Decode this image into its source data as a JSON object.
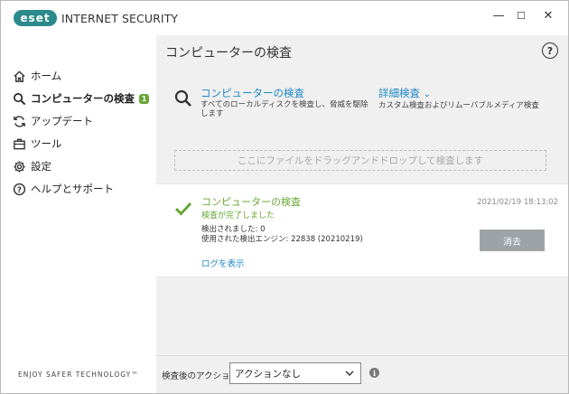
{
  "app": {
    "logo_badge": "eset",
    "product_name": "INTERNET SECURITY",
    "tagline": "ENJOY SAFER TECHNOLOGY™"
  },
  "window_controls": {
    "minimize": "—",
    "maximize": "☐",
    "close": "✕"
  },
  "sidebar": {
    "items": [
      {
        "label": "ホーム",
        "icon": "home-icon"
      },
      {
        "label": "コンピューターの検査",
        "icon": "search-icon",
        "badge": "1",
        "active": true
      },
      {
        "label": "アップデート",
        "icon": "update-icon"
      },
      {
        "label": "ツール",
        "icon": "toolbox-icon"
      },
      {
        "label": "設定",
        "icon": "gear-icon"
      },
      {
        "label": "ヘルプとサポート",
        "icon": "help-circle-icon"
      }
    ]
  },
  "main": {
    "title": "コンピューターの検査",
    "help": "?",
    "options": [
      {
        "title": "コンピューターの検査",
        "desc_line1": "すべてのローカルディスクを検査し、脅威を駆除",
        "desc_line2": "します"
      },
      {
        "title": "詳細検査",
        "chevron": "⌄",
        "desc_line1": "カスタム検査およびリムーバブルメディア検査"
      }
    ],
    "dropzone": "ここにファイルをドラッグアンドドロップして検査します",
    "result": {
      "title": "コンピューターの検査",
      "status": "検査が完了しました",
      "timestamp": "2021/02/19 18:13:02",
      "detected": "検出されました: 0",
      "engine": "使用された検出エンジン: 22838 (20210219)",
      "clear_button": "消去",
      "log_link": "ログを表示"
    },
    "after_scan": {
      "label": "検査後のアクション",
      "selected": "アクションなし",
      "info": "i"
    }
  },
  "colors": {
    "accent_blue": "#1e88c8",
    "success_green": "#68a635",
    "logo_teal": "#2b8a8c"
  }
}
